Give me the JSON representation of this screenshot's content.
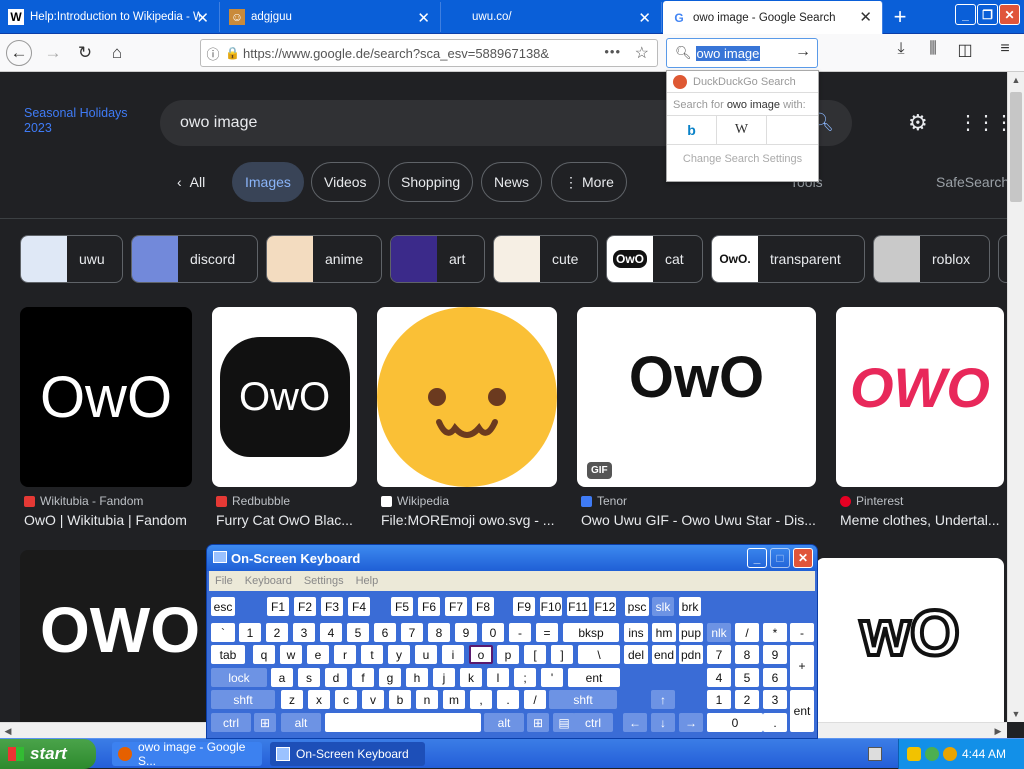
{
  "tabs": [
    {
      "title": "Help:Introduction to Wikipedia - W",
      "fav": "W"
    },
    {
      "title": "adgjguu",
      "fav": "☺"
    },
    {
      "title": "uwu.co/",
      "fav": ""
    },
    {
      "title": "owo image - Google Search",
      "fav": "G"
    }
  ],
  "nav": {
    "url": "https://www.google.de/search?sca_esv=588967138&",
    "search_text": "owo image"
  },
  "search_dropdown": {
    "engine_header": "DuckDuckGo Search",
    "search_for_prefix": "Search for",
    "search_for_term": "owo image",
    "search_for_suffix": "with:",
    "engines": [
      "b",
      "W"
    ],
    "change_settings": "Change Search Settings"
  },
  "google": {
    "seasonal": "Seasonal Holidays 2023",
    "query": "owo image",
    "filters": [
      "All",
      "Images",
      "Videos",
      "Shopping",
      "News",
      "More"
    ],
    "tools": "Tools",
    "safesearch": "SafeSearch",
    "related": [
      "uwu",
      "discord",
      "anime",
      "art",
      "cute",
      "cat",
      "transparent",
      "roblox"
    ],
    "related_thumb_text": [
      "",
      "",
      "",
      "",
      "",
      "OwO",
      "OwO.",
      ""
    ],
    "results": [
      {
        "image_text": "OwO",
        "source": "Wikitubia - Fandom",
        "title": "OwO | Wikitubia | Fandom",
        "src_color": "#e53935"
      },
      {
        "image_text": "OwO",
        "source": "Redbubble",
        "title": "Furry Cat OwO Blac...",
        "src_color": "#e53935"
      },
      {
        "image_text": "",
        "source": "Wikipedia",
        "title": "File:MOREmoji owo.svg - ...",
        "src_color": "#ffffff"
      },
      {
        "image_text": "OwO",
        "source": "Tenor",
        "title": "Owo Uwu GIF - Owo Uwu Star - Dis...",
        "src_color": "#3f7bf5",
        "badge": "GIF"
      },
      {
        "image_text": "OWO",
        "source": "Pinterest",
        "title": "Meme clothes, Undertal...",
        "src_color": "#e60023"
      }
    ],
    "row2": [
      {
        "image_text": "OWO"
      },
      {
        "image_text": "wO"
      }
    ]
  },
  "osk": {
    "title": "On-Screen Keyboard",
    "menu": [
      "File",
      "Keyboard",
      "Settings",
      "Help"
    ],
    "rows": [
      [
        "esc",
        "F1",
        "F2",
        "F3",
        "F4",
        "F5",
        "F6",
        "F7",
        "F8",
        "F9",
        "F10",
        "F11",
        "F12",
        "psc",
        "slk",
        "brk"
      ],
      [
        "`",
        "1",
        "2",
        "3",
        "4",
        "5",
        "6",
        "7",
        "8",
        "9",
        "0",
        "-",
        "=",
        "bksp",
        "ins",
        "hm",
        "pup",
        "nlk",
        "/",
        "*",
        "-"
      ],
      [
        "tab",
        "q",
        "w",
        "e",
        "r",
        "t",
        "y",
        "u",
        "i",
        "o",
        "p",
        "[",
        "]",
        "\\",
        "del",
        "end",
        "pdn",
        "7",
        "8",
        "9",
        "+"
      ],
      [
        "lock",
        "a",
        "s",
        "d",
        "f",
        "g",
        "h",
        "j",
        "k",
        "l",
        ";",
        "'",
        "ent",
        "4",
        "5",
        "6"
      ],
      [
        "shft",
        "z",
        "x",
        "c",
        "v",
        "b",
        "n",
        "m",
        ",",
        ".",
        "/",
        "shft",
        "↑",
        "1",
        "2",
        "3",
        "ent"
      ],
      [
        "ctrl",
        "alt",
        "alt",
        "ctrl",
        "←",
        "↓",
        "→",
        "0",
        "."
      ]
    ]
  },
  "taskbar": {
    "start": "start",
    "buttons": [
      "owo image - Google S...",
      "On-Screen Keyboard"
    ],
    "clock": "4:44 AM"
  }
}
